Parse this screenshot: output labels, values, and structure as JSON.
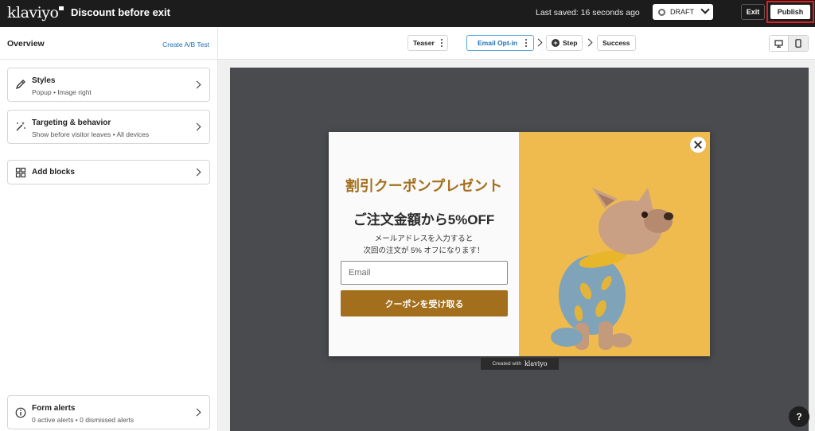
{
  "app": {
    "logo_text": "klaviyo",
    "document_title": "Discount before exit",
    "last_saved": "Last saved: 16 seconds ago",
    "status": "DRAFT",
    "exit_label": "Exit",
    "publish_label": "Publish"
  },
  "sidebar": {
    "title": "Overview",
    "ab_test_link": "Create A/B Test",
    "cards": [
      {
        "title": "Styles",
        "subtitle": "Popup • Image right",
        "icon": "brush-icon"
      },
      {
        "title": "Targeting & behavior",
        "subtitle": "Show before visitor leaves • All devices",
        "icon": "magic-wand-icon"
      },
      {
        "title": "Add blocks",
        "subtitle": "",
        "icon": "blocks-grid-icon"
      }
    ],
    "form_alerts": {
      "title": "Form alerts",
      "subtitle": "0 active alerts • 0 dismissed alerts",
      "icon": "info-icon"
    }
  },
  "steps": {
    "teaser": "Teaser",
    "email_optin": "Email Opt-in",
    "add_step": "Step",
    "success": "Success",
    "active": "email_optin"
  },
  "device": {
    "selected": "desktop",
    "options": [
      "desktop",
      "mobile"
    ]
  },
  "popup": {
    "headline": "割引クーポンプレゼント",
    "subheadline": "ご注文金額から5%OFF",
    "body_line1": "メールアドレスを入力すると",
    "body_line2": "次回の注文が 5% オフになります！",
    "email_placeholder": "Email",
    "cta_label": "クーポンを受け取る",
    "accent_color": "#a36f1c",
    "image_bg_color": "#f0bb4e"
  },
  "badge": {
    "prefix": "Created with",
    "brand": "klaviyo"
  },
  "help_label": "?"
}
